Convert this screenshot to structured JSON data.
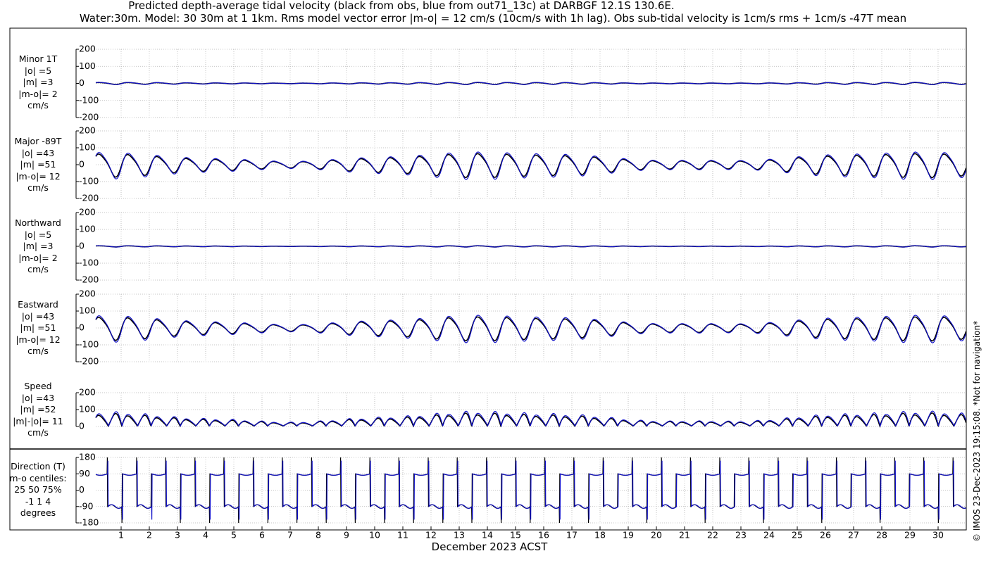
{
  "title": {
    "line1": "Predicted depth-average tidal velocity (black from obs, blue from out71_13c) at DARBGF 12.1S 130.6E.",
    "line2": "Water:30m. Model: 30 30m at 1 1km. Rms model vector error |m-o| = 12 cm/s (10cm/s with 1h lag). Obs sub-tidal velocity is 1cm/s rms + 1cm/s -47T mean"
  },
  "stamp": "© IMOS 23-Dec-2023 19:15:08. *Not for navigation*",
  "colors": {
    "obs": "#000000",
    "model": "#1010c8",
    "grid": "#b4b4b4"
  },
  "chart_data": {
    "type": "line",
    "xlabel": "December 2023 ACST",
    "x_ticks": [
      "1",
      "2",
      "3",
      "4",
      "5",
      "6",
      "7",
      "8",
      "9",
      "10",
      "11",
      "12",
      "13",
      "14",
      "15",
      "16",
      "17",
      "18",
      "19",
      "20",
      "21",
      "22",
      "23",
      "24",
      "25",
      "26",
      "27",
      "28",
      "29",
      "30"
    ],
    "xlim_days": [
      0.1,
      31
    ],
    "grid": true,
    "panels": [
      {
        "id": "minor",
        "label": [
          "Minor 1T",
          "|o| =5",
          "|m| =3",
          "|m-o|= 2",
          "cm/s"
        ],
        "yticks": [
          "200",
          "100",
          "0",
          "-100",
          "-200"
        ],
        "ylim": [
          -200,
          200
        ],
        "amplitude": 5,
        "offset": 0,
        "series": [
          {
            "role": "obs",
            "color": "#000000"
          },
          {
            "role": "model",
            "color": "#1010c8"
          }
        ]
      },
      {
        "id": "major",
        "label": [
          "Major -89T",
          "|o| =43",
          "|m| =51",
          "|m-o|= 12",
          "cm/s"
        ],
        "yticks": [
          "200",
          "100",
          "0",
          "-100",
          "-200"
        ],
        "ylim": [
          -200,
          200
        ],
        "amplitude": 60,
        "offset": 0,
        "series": [
          {
            "role": "obs",
            "color": "#000000"
          },
          {
            "role": "model",
            "color": "#1010c8"
          }
        ]
      },
      {
        "id": "north",
        "label": [
          "Northward",
          "|o| =5",
          "|m| =3",
          "|m-o|= 2",
          "cm/s"
        ],
        "yticks": [
          "200",
          "100",
          "0",
          "-100",
          "-200"
        ],
        "ylim": [
          -200,
          200
        ],
        "amplitude": 3,
        "offset": 0,
        "series": [
          {
            "role": "obs",
            "color": "#000000"
          },
          {
            "role": "model",
            "color": "#1010c8"
          }
        ]
      },
      {
        "id": "east",
        "label": [
          "Eastward",
          "|o| =43",
          "|m| =51",
          "|m-o|= 12",
          "cm/s"
        ],
        "yticks": [
          "200",
          "100",
          "0",
          "-100",
          "-200"
        ],
        "ylim": [
          -200,
          200
        ],
        "amplitude": 60,
        "offset": 0,
        "series": [
          {
            "role": "obs",
            "color": "#000000"
          },
          {
            "role": "model",
            "color": "#1010c8"
          }
        ]
      },
      {
        "id": "speed",
        "label": [
          "Speed",
          "|o| =43",
          "|m| =52",
          "|m|-|o|= 11",
          "cm/s"
        ],
        "yticks": [
          "200",
          "100",
          "0"
        ],
        "ylim": [
          0,
          200
        ],
        "amplitude": 60,
        "offset": 0
      },
      {
        "id": "direction",
        "label": [
          "Direction (T)",
          "m-o centiles:",
          "25  50  75%",
          "-1  1  4",
          "degrees"
        ],
        "yticks": [
          "180",
          "90",
          "0",
          "-90",
          "-180"
        ],
        "ylim": [
          -180,
          180
        ]
      }
    ]
  }
}
